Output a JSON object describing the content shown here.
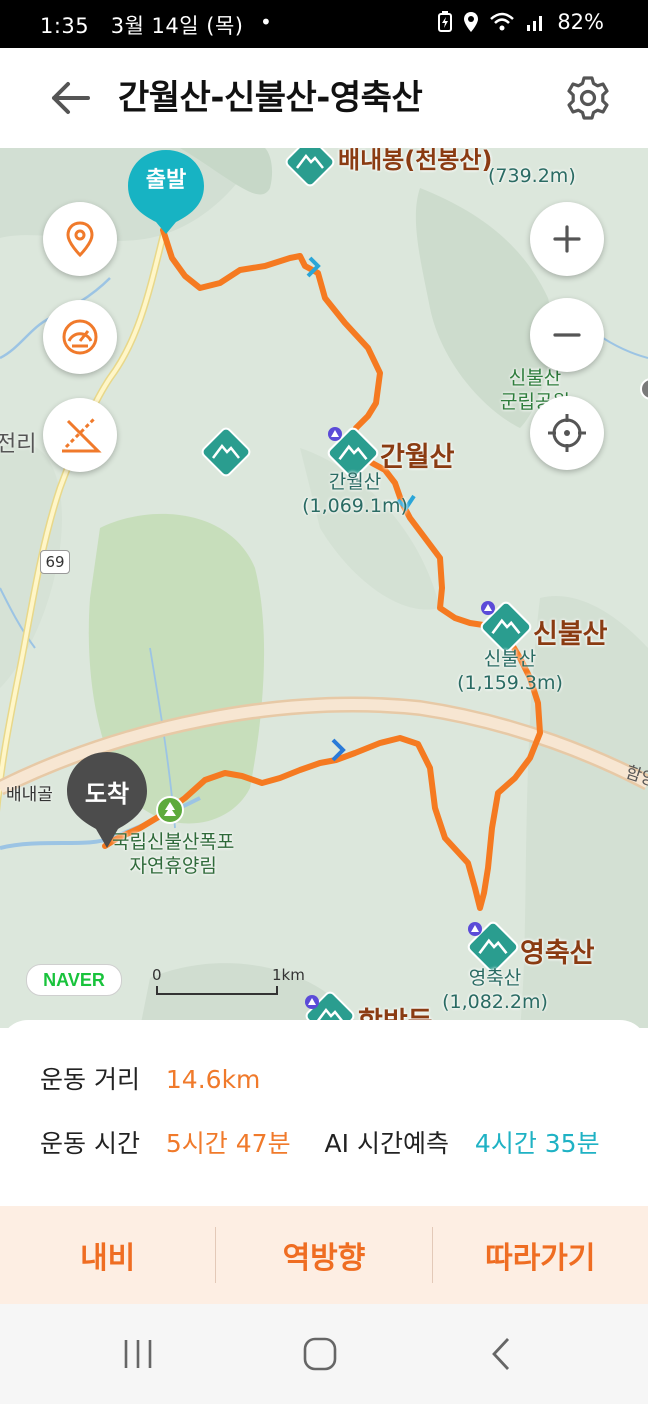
{
  "status_bar": {
    "time": "1:35",
    "date": "3월 14일 (목)",
    "dot": "•",
    "battery": "82%"
  },
  "header": {
    "title": "간월산-신불산-영축산"
  },
  "map": {
    "start_label": "출발",
    "end_label": "도착",
    "peaks": [
      {
        "name": "간월산",
        "sub_name": "간월산",
        "height": "(1,069.1m)"
      },
      {
        "name": "신불산",
        "sub_name": "신불산",
        "height": "(1,159.3m)"
      },
      {
        "name": "영축산",
        "sub_name": "영축산",
        "height": "(1,082.2m)"
      },
      {
        "name": "배내봉(천봉산)",
        "height": "(739.2m)"
      },
      {
        "name": "함박등"
      }
    ],
    "park_label": "신불산\n군립공원",
    "forest_label": "국립신불산폭포\n자연휴양림",
    "village_label": "배내골",
    "village_left": "전리",
    "road_label": "69",
    "highway_label": "함양",
    "naver_logo": "NAVER",
    "scale_zero": "0",
    "scale_one": "1km"
  },
  "stats": {
    "distance_label": "운동 거리",
    "distance_value": "14.6km",
    "time_label": "운동 시간",
    "time_value": "5시간 47분",
    "ai_label": "AI 시간예측",
    "ai_value": "4시간 35분"
  },
  "actions": {
    "navi": "내비",
    "reverse": "역방향",
    "follow": "따라가기"
  },
  "colors": {
    "route": "#f57a21",
    "accent": "#ef6d22",
    "teal": "#1fb2c4",
    "peak": "#2a9d8f"
  }
}
